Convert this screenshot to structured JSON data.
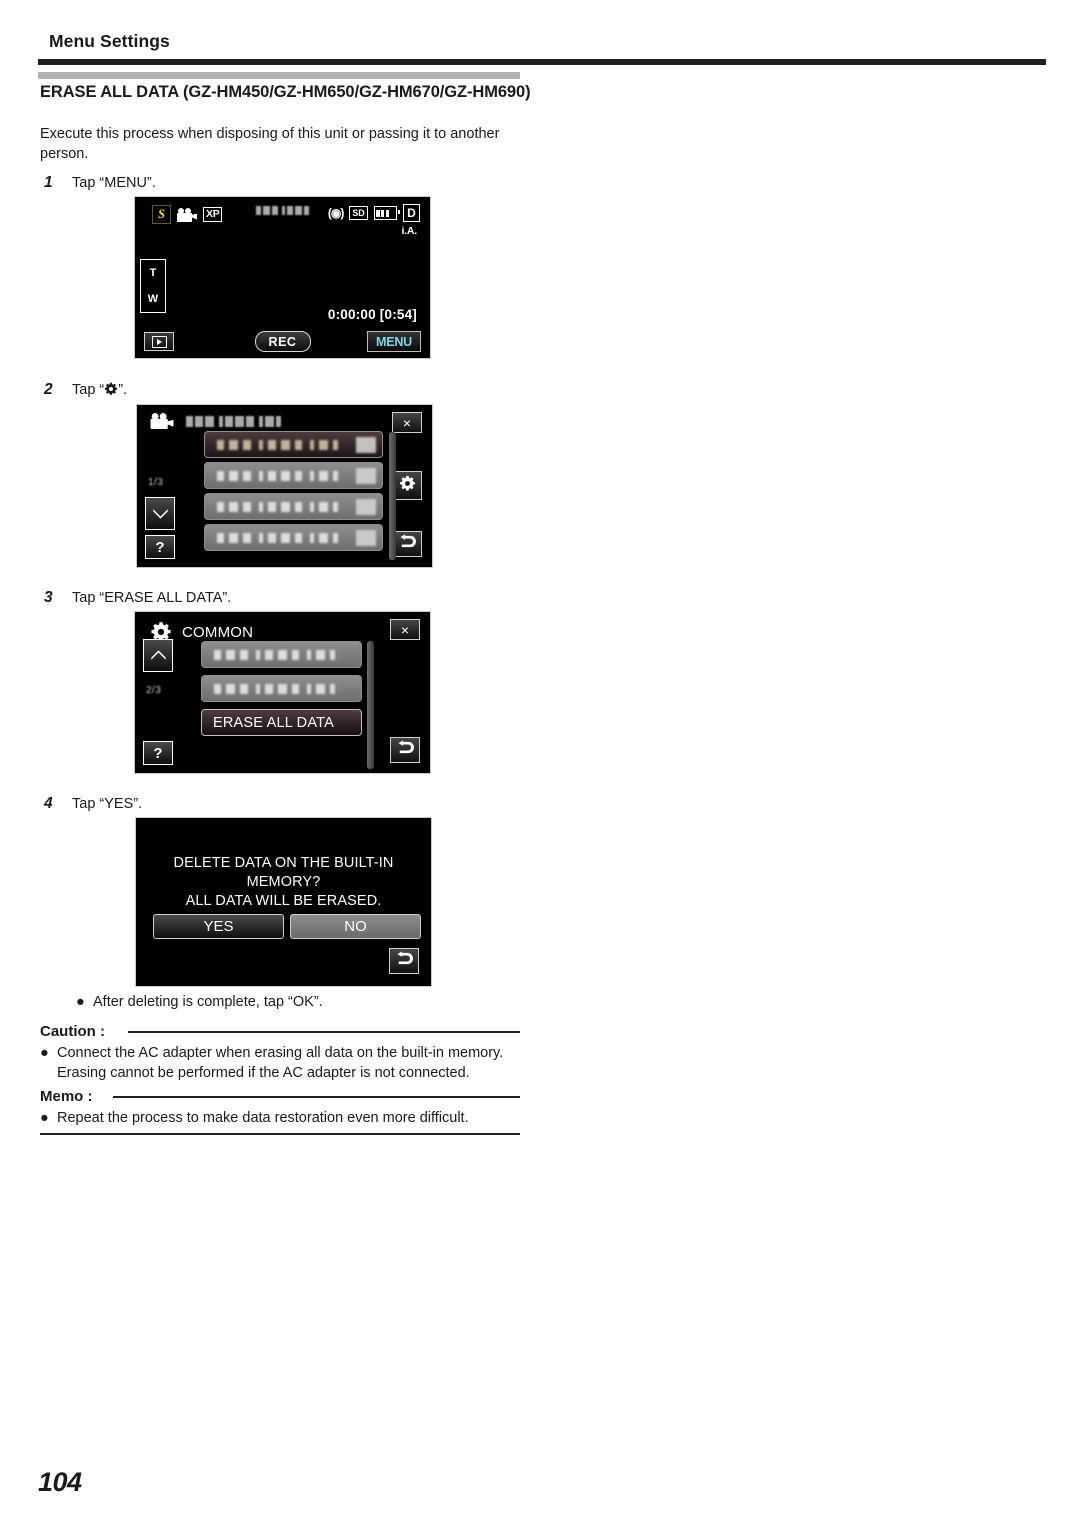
{
  "header": {
    "running_head": "Menu Settings"
  },
  "section": {
    "title": "ERASE ALL DATA (GZ-HM450/GZ-HM650/GZ-HM670/GZ-HM690)",
    "intro": "Execute this process when disposing of this unit or passing it to another person."
  },
  "steps": [
    {
      "num": "1",
      "text_before": "Tap “MENU”.",
      "text_after": ""
    },
    {
      "num": "2",
      "text_before": "Tap “",
      "text_after": "”."
    },
    {
      "num": "3",
      "text_before": "Tap “ERASE ALL DATA”.",
      "text_after": ""
    },
    {
      "num": "4",
      "text_before": "Tap “YES”.",
      "text_after": ""
    }
  ],
  "shot1": {
    "name": "record-standby-screen",
    "mode_badge": "S",
    "quality_label": "XP",
    "ia_label": "i.A.",
    "sd_label": "SD",
    "d_label": "D",
    "zoom_tele": "T",
    "zoom_wide": "W",
    "timecode": "0:00:00 [0:54]",
    "rec_label": "REC",
    "menu_label": "MENU",
    "menu_color": "#7fd8e8",
    "mode_badge_color": "#f2e01c"
  },
  "shot2": {
    "name": "video-menu-screen",
    "page_indicator": "1/3",
    "help_label": "?",
    "close_label": "×",
    "rows": [
      {
        "selected": true
      },
      {
        "selected": false
      },
      {
        "selected": false
      },
      {
        "selected": false
      }
    ]
  },
  "shot3": {
    "name": "common-menu-screen",
    "title": "COMMON",
    "page_indicator": "2/3",
    "help_label": "?",
    "close_label": "×",
    "erase_label": "ERASE ALL DATA"
  },
  "shot4": {
    "name": "delete-confirm-dialog",
    "message_line1": "DELETE DATA ON THE BUILT-IN",
    "message_line2": "MEMORY?",
    "message_line3": "ALL DATA WILL BE ERASED.",
    "yes_label": "YES",
    "no_label": "NO"
  },
  "after_note": "After deleting is complete, tap “OK”.",
  "caution": {
    "heading": "Caution :",
    "items": [
      "Connect the AC adapter when erasing all data on the built-in memory. Erasing cannot be performed if the AC adapter is not connected."
    ]
  },
  "memo": {
    "heading": "Memo :",
    "items": [
      "Repeat the process to make data restoration even more difficult."
    ]
  },
  "folio": "104"
}
